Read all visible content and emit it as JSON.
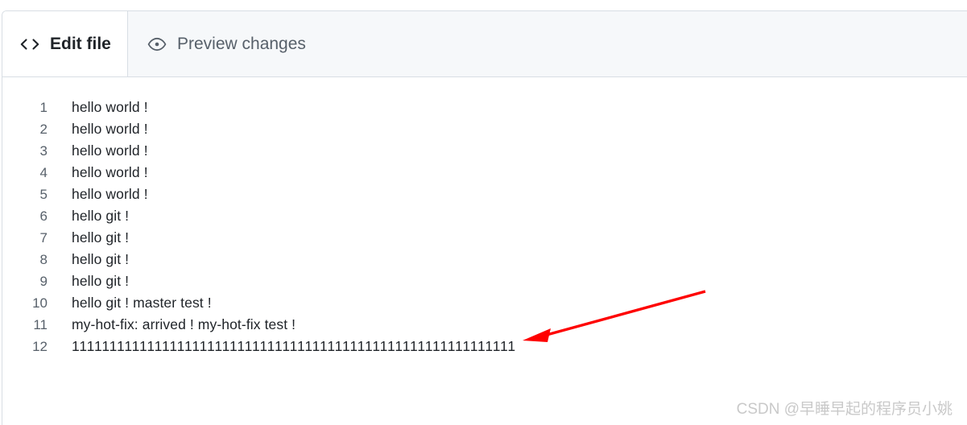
{
  "tabs": [
    {
      "id": "edit-file",
      "label": "Edit file",
      "icon": "code-icon",
      "active": true
    },
    {
      "id": "preview-changes",
      "label": "Preview changes",
      "icon": "eye-icon",
      "active": false
    }
  ],
  "editor": {
    "lines": [
      {
        "number": "1",
        "text": "hello world !"
      },
      {
        "number": "2",
        "text": "hello world !"
      },
      {
        "number": "3",
        "text": "hello world !"
      },
      {
        "number": "4",
        "text": "hello world !"
      },
      {
        "number": "5",
        "text": "hello world !"
      },
      {
        "number": "6",
        "text": "hello git !"
      },
      {
        "number": "7",
        "text": "hello git !"
      },
      {
        "number": "8",
        "text": "hello git !"
      },
      {
        "number": "9",
        "text": "hello git !"
      },
      {
        "number": "10",
        "text": "hello git ! master test !"
      },
      {
        "number": "11",
        "text": "my-hot-fix: arrived ! my-hot-fix test !"
      },
      {
        "number": "12",
        "text": "11111111111111111111111111111111111111111111111111111111111"
      }
    ]
  },
  "annotation": {
    "arrow_color": "#fe0000",
    "name": "red-arrow-annotation"
  },
  "watermark": {
    "text": "CSDN @早睡早起的程序员小姚"
  },
  "colors": {
    "tab_bar_bg": "#f6f8fa",
    "border": "#d8dee4",
    "active_tab_text": "#1f2328",
    "inactive_tab_text": "#57606a",
    "line_number": "#57606a",
    "code_text": "#1f2328",
    "watermark": "#c9c9c9"
  }
}
